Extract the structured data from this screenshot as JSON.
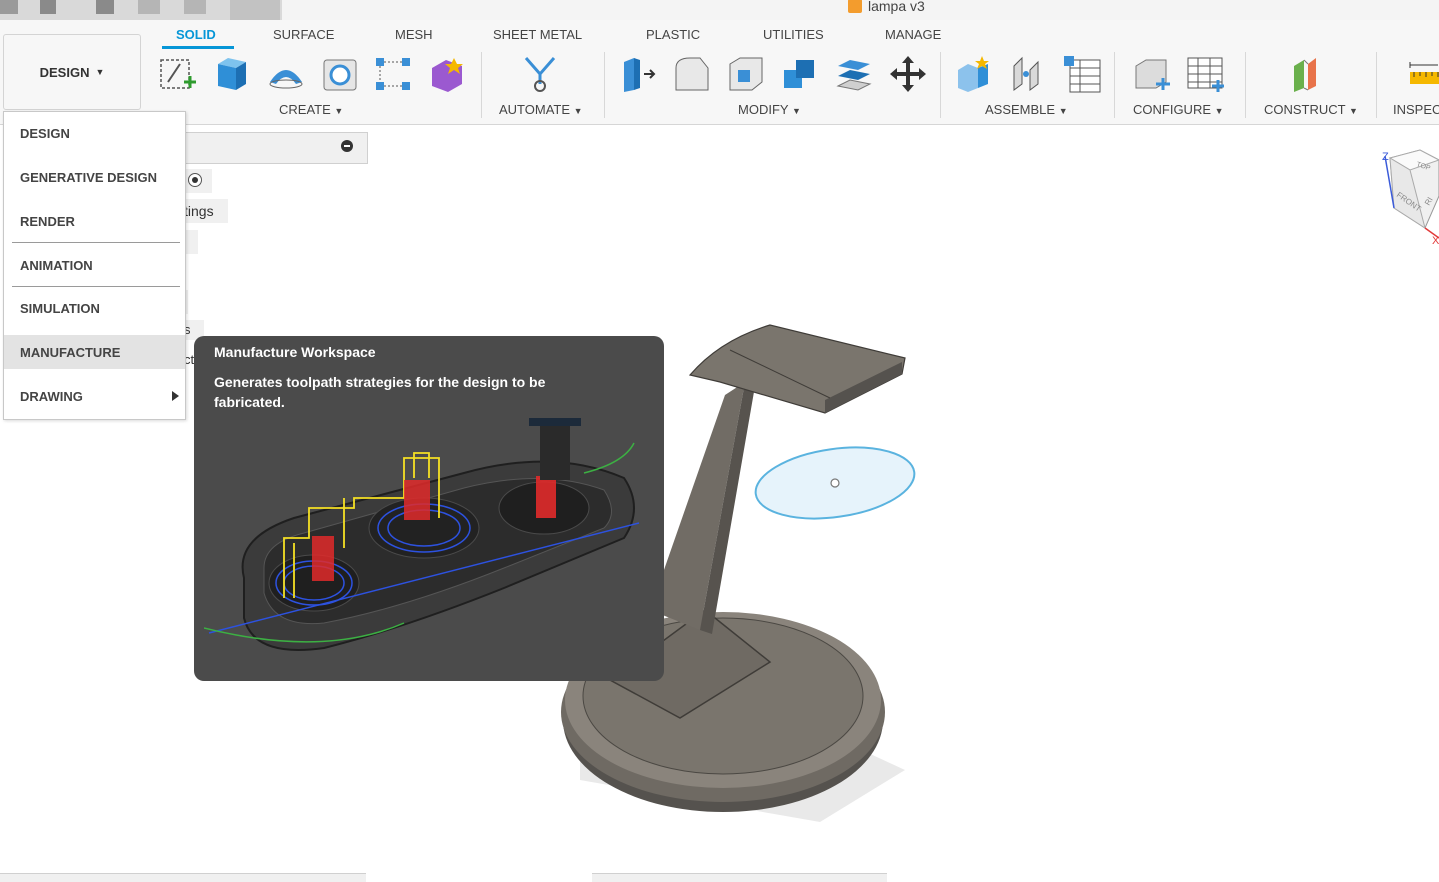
{
  "document": {
    "title": "lampa v3"
  },
  "workspace_switcher": {
    "label": "DESIGN"
  },
  "tabs": [
    "SOLID",
    "SURFACE",
    "MESH",
    "SHEET METAL",
    "PLASTIC",
    "UTILITIES",
    "MANAGE"
  ],
  "active_tab": "SOLID",
  "toolbar_groups": [
    "CREATE",
    "AUTOMATE",
    "MODIFY",
    "ASSEMBLE",
    "CONFIGURE",
    "CONSTRUCT",
    "INSPEC"
  ],
  "browser_fragments": [
    "tings",
    "s",
    "cti"
  ],
  "workspace_menu": {
    "items": [
      "DESIGN",
      "GENERATIVE DESIGN",
      "RENDER",
      "ANIMATION",
      "SIMULATION",
      "MANUFACTURE",
      "DRAWING"
    ],
    "highlighted": "MANUFACTURE"
  },
  "tooltip": {
    "title": "Manufacture Workspace",
    "description": "Generates toolpath strategies for the design to be fabricated."
  },
  "viewcube": {
    "z_label": "Z",
    "x_label": "X",
    "top": "TOP",
    "front": "FRONT",
    "right": "RI"
  },
  "colors": {
    "accent": "#0696d7",
    "tooltip_bg": "#4b4b4b",
    "model": "#6f6a63",
    "sketch": "#5ab3df"
  }
}
